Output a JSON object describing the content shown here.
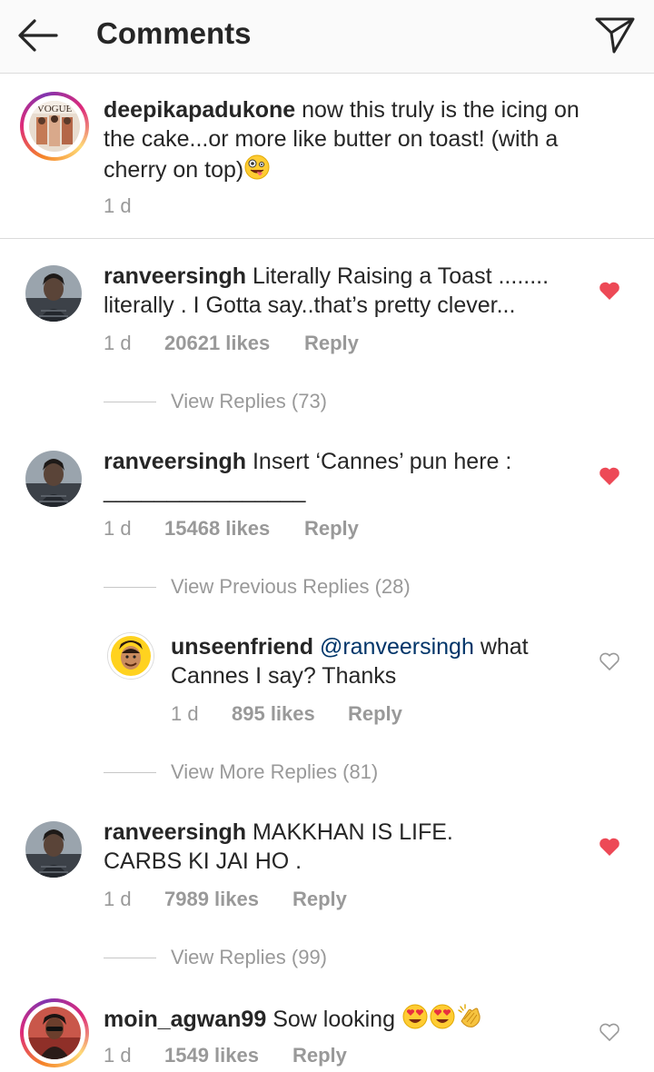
{
  "header": {
    "title": "Comments",
    "back_icon": "arrow-left-icon",
    "send_icon": "paper-plane-icon"
  },
  "caption": {
    "username": "deepikapadukone",
    "text": "now this truly is the icing on the cake...or more like butter on toast! (with a cherry on top)",
    "emoji": "zany-face",
    "time": "1 d",
    "avatar_text": "VOGUE"
  },
  "comments": [
    {
      "username": "ranveersingh",
      "text": "Literally Raising a Toast ........ literally . I Gotta say..that’s pretty clever...",
      "time": "1 d",
      "likes": "20621 likes",
      "reply": "Reply",
      "liked": true,
      "view_replies": "View Replies (73)"
    },
    {
      "username": "ranveersingh",
      "text": "Insert ‘Cannes’ pun here :",
      "text_line2": "________________",
      "time": "1 d",
      "likes": "15468 likes",
      "reply": "Reply",
      "liked": true,
      "view_previous": "View Previous Replies (28)",
      "reply_item": {
        "username": "unseenfriend",
        "mention": "@ranveersingh",
        "text": "what Cannes I say? Thanks",
        "time": "1 d",
        "likes": "895 likes",
        "reply": "Reply",
        "liked": false
      },
      "view_more": "View More Replies (81)"
    },
    {
      "username": "ranveersingh",
      "text": "MAKKHAN IS LIFE. CARBS KI JAI HO .",
      "time": "1 d",
      "likes": "7989 likes",
      "reply": "Reply",
      "liked": true,
      "view_replies": "View Replies (99)"
    },
    {
      "username": "moin_agwan99",
      "text": "Sow looking",
      "emojis": [
        "heart-eyes",
        "heart-eyes",
        "clapping-hands"
      ],
      "time": "1 d",
      "likes": "1549 likes",
      "reply": "Reply",
      "liked": false
    }
  ],
  "colors": {
    "like_red": "#ed4956",
    "meta_gray": "#999999",
    "mention_blue": "#003569"
  }
}
